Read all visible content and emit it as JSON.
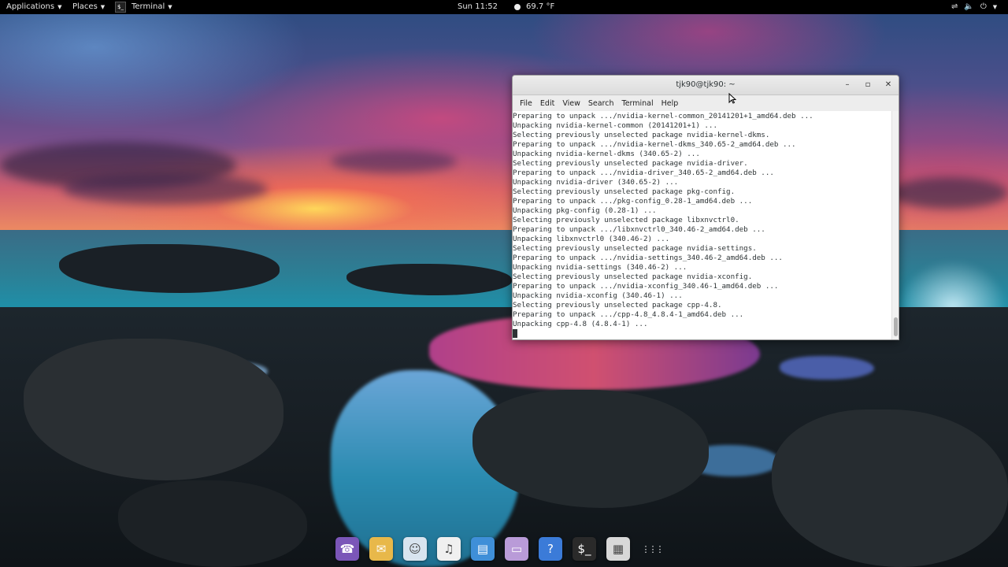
{
  "topbar": {
    "applications": "Applications",
    "places": "Places",
    "terminal": "Terminal",
    "clock": "Sun 11:52",
    "weather": "69.7 °F"
  },
  "window": {
    "title": "tjk90@tjk90: ~",
    "menu": [
      "File",
      "Edit",
      "View",
      "Search",
      "Terminal",
      "Help"
    ],
    "lines": [
      "Preparing to unpack .../nvidia-kernel-common_20141201+1_amd64.deb ...",
      "Unpacking nvidia-kernel-common (20141201+1) ...",
      "Selecting previously unselected package nvidia-kernel-dkms.",
      "Preparing to unpack .../nvidia-kernel-dkms_340.65-2_amd64.deb ...",
      "Unpacking nvidia-kernel-dkms (340.65-2) ...",
      "Selecting previously unselected package nvidia-driver.",
      "Preparing to unpack .../nvidia-driver_340.65-2_amd64.deb ...",
      "Unpacking nvidia-driver (340.65-2) ...",
      "Selecting previously unselected package pkg-config.",
      "Preparing to unpack .../pkg-config_0.28-1_amd64.deb ...",
      "Unpacking pkg-config (0.28-1) ...",
      "Selecting previously unselected package libxnvctrl0.",
      "Preparing to unpack .../libxnvctrl0_340.46-2_amd64.deb ...",
      "Unpacking libxnvctrl0 (340.46-2) ...",
      "Selecting previously unselected package nvidia-settings.",
      "Preparing to unpack .../nvidia-settings_340.46-2_amd64.deb ...",
      "Unpacking nvidia-settings (340.46-2) ...",
      "Selecting previously unselected package nvidia-xconfig.",
      "Preparing to unpack .../nvidia-xconfig_340.46-1_amd64.deb ...",
      "Unpacking nvidia-xconfig (340.46-1) ...",
      "Selecting previously unselected package cpp-4.8.",
      "Preparing to unpack .../cpp-4.8_4.8.4-1_amd64.deb ...",
      "Unpacking cpp-4.8 (4.8.4-1) ..."
    ]
  },
  "dock": [
    {
      "name": "empathy-icon",
      "glyph": "☎",
      "color": "#7b56b8"
    },
    {
      "name": "mail-icon",
      "glyph": "✉",
      "color": "#e8b84a"
    },
    {
      "name": "pidgin-icon",
      "glyph": "☺",
      "color": "#d8e4ef"
    },
    {
      "name": "rhythmbox-music-icon",
      "glyph": "♫",
      "color": "#f0f0f0"
    },
    {
      "name": "documents-icon",
      "glyph": "▤",
      "color": "#3f8fd8"
    },
    {
      "name": "files-folder-icon",
      "glyph": "▭",
      "color": "#b99bd8"
    },
    {
      "name": "help-icon",
      "glyph": "?",
      "color": "#3b7bd8"
    },
    {
      "name": "terminal-icon",
      "glyph": "$_",
      "color": "#2a2a2a"
    },
    {
      "name": "software-icon",
      "glyph": "▦",
      "color": "#d8d8d8"
    },
    {
      "name": "show-applications-grid-icon",
      "glyph": "⋮⋮⋮",
      "color": "transparent"
    }
  ]
}
